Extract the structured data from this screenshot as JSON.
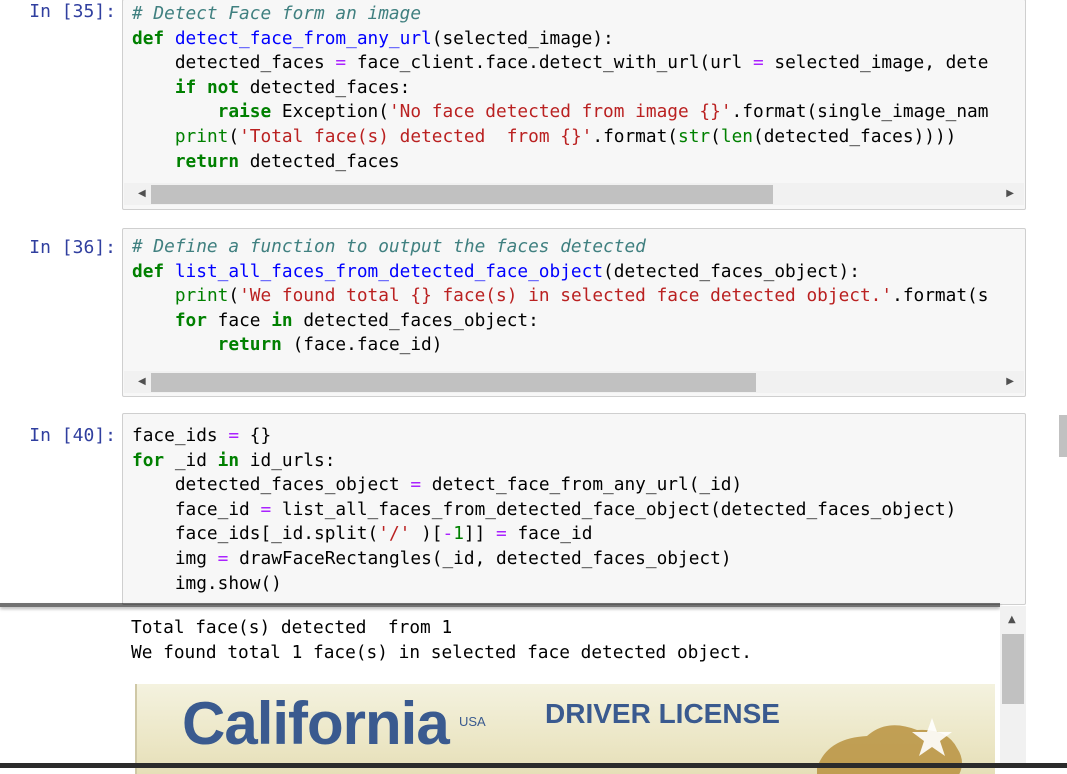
{
  "cells": [
    {
      "prompt": "In [35]:",
      "lines": [
        [
          [
            "cm",
            "# Detect Face form an image"
          ]
        ],
        [
          [
            "kw",
            "def "
          ],
          [
            "fn",
            "detect_face_from_any_url"
          ],
          [
            "",
            "(selected_image):"
          ]
        ],
        [
          [
            "",
            "    detected_faces "
          ],
          [
            "op",
            "="
          ],
          [
            "",
            " face_client.face.detect_with_url(url "
          ],
          [
            "op",
            "="
          ],
          [
            "",
            " selected_image, dete"
          ]
        ],
        [
          [
            "",
            "    "
          ],
          [
            "kw",
            "if"
          ],
          [
            "",
            ""
          ],
          [
            "kw",
            " not"
          ],
          [
            "",
            " detected_faces:"
          ]
        ],
        [
          [
            "",
            "        "
          ],
          [
            "kw",
            "raise"
          ],
          [
            "",
            " Exception("
          ],
          [
            "st",
            "'No face detected from image {}'"
          ],
          [
            "",
            ".format(single_image_nam"
          ]
        ],
        [
          [
            "",
            "    "
          ],
          [
            "bi",
            "print"
          ],
          [
            "",
            "("
          ],
          [
            "st",
            "'Total face(s) detected  from {}'"
          ],
          [
            "",
            ".format("
          ],
          [
            "bi",
            "str"
          ],
          [
            "",
            "("
          ],
          [
            "bi",
            "len"
          ],
          [
            "",
            "(detected_faces))))"
          ]
        ],
        [
          [
            "",
            "    "
          ],
          [
            "kw",
            "return"
          ],
          [
            "",
            " detected_faces"
          ]
        ]
      ]
    },
    {
      "prompt": "In [36]:",
      "lines": [
        [
          [
            "cm",
            "# Define a function to output the faces detected"
          ]
        ],
        [
          [
            "kw",
            "def "
          ],
          [
            "fn",
            "list_all_faces_from_detected_face_object"
          ],
          [
            "",
            "(detected_faces_object):"
          ]
        ],
        [
          [
            "",
            "    "
          ],
          [
            "bi",
            "print"
          ],
          [
            "",
            "("
          ],
          [
            "st",
            "'We found total {} face(s) in selected face detected object.'"
          ],
          [
            "",
            ".format(s"
          ]
        ],
        [
          [
            "",
            "    "
          ],
          [
            "kw",
            "for"
          ],
          [
            "",
            " face "
          ],
          [
            "kw",
            "in"
          ],
          [
            "",
            " detected_faces_object:"
          ]
        ],
        [
          [
            "",
            "        "
          ],
          [
            "kw",
            "return"
          ],
          [
            "",
            " (face.face_id)"
          ]
        ]
      ]
    },
    {
      "prompt": "In [40]:",
      "lines": [
        [
          [
            "",
            "face_ids "
          ],
          [
            "op",
            "="
          ],
          [
            "",
            " {}"
          ]
        ],
        [
          [
            "kw",
            "for"
          ],
          [
            "",
            " _id "
          ],
          [
            "kw",
            "in"
          ],
          [
            "",
            " id_urls:"
          ]
        ],
        [
          [
            "",
            "    detected_faces_object "
          ],
          [
            "op",
            "="
          ],
          [
            "",
            " detect_face_from_any_url(_id)"
          ]
        ],
        [
          [
            "",
            "    face_id "
          ],
          [
            "op",
            "="
          ],
          [
            "",
            " list_all_faces_from_detected_face_object(detected_faces_object)"
          ]
        ],
        [
          [
            "",
            "    face_ids[_id.split("
          ],
          [
            "st",
            "'/'"
          ],
          [
            "",
            " )["
          ],
          [
            "op",
            "-"
          ],
          [
            "nm",
            "1"
          ],
          [
            "",
            "]] "
          ],
          [
            "op",
            "="
          ],
          [
            "",
            " face_id"
          ]
        ],
        [
          [
            "",
            "    img "
          ],
          [
            "op",
            "="
          ],
          [
            "",
            " drawFaceRectangles(_id, detected_faces_object)"
          ]
        ],
        [
          [
            "",
            "    img.show()"
          ]
        ]
      ]
    }
  ],
  "output": {
    "lines": [
      "Total face(s) detected  from 1",
      "We found total 1 face(s) in selected face detected object."
    ]
  },
  "license_image": {
    "title": "California",
    "country": "USA",
    "doc_type": "DRIVER LICENSE"
  },
  "scrollbars": {
    "left_arrow": "◀",
    "right_arrow": "▶",
    "up_arrow": "▲"
  },
  "colors": {
    "prompt": "#303f9f",
    "keyword": "#008000",
    "comment": "#408080",
    "string": "#ba2121",
    "operator": "#aa22ff",
    "function_def": "#0000ff"
  }
}
